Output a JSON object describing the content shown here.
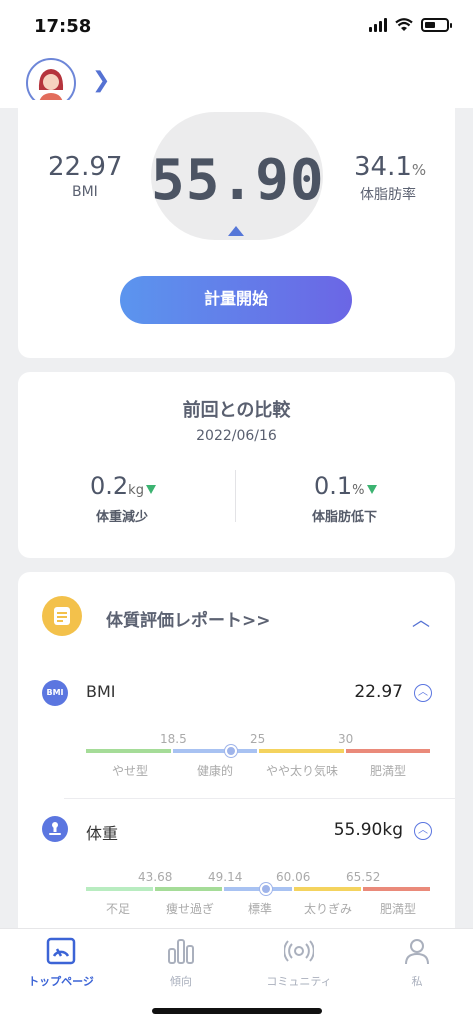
{
  "status_bar": {
    "time": "17:58"
  },
  "summary": {
    "bmi_value": "22.97",
    "bmi_label": "BMI",
    "weight_value": "55.90",
    "body_fat_value": "34.1",
    "body_fat_unit": "%",
    "body_fat_label": "体脂肪率",
    "start_button": "計量開始"
  },
  "comparison": {
    "title": "前回との比較",
    "date": "2022/06/16",
    "weight_change": "0.2",
    "weight_unit": "kg",
    "weight_label": "体重減少",
    "fat_change": "0.1",
    "fat_unit": "%",
    "fat_label": "体脂肪低下"
  },
  "report": {
    "title": "体質評価レポート>>",
    "bmi": {
      "icon_text": "BMI",
      "name": "BMI",
      "value": "22.97",
      "ticks": [
        "18.5",
        "25",
        "30"
      ],
      "categories": [
        "やせ型",
        "健康的",
        "やや太り気味",
        "肥満型"
      ],
      "marker_fraction": 0.42,
      "colors": [
        "#a5dc98",
        "#a8c2f2",
        "#f4d35e",
        "#ea8a7a"
      ]
    },
    "weight": {
      "name": "体重",
      "value": "55.90kg",
      "ticks": [
        "43.68",
        "49.14",
        "60.06",
        "65.52"
      ],
      "categories": [
        "不足",
        "痩せ過ぎ",
        "標準",
        "太りぎみ",
        "肥満型"
      ],
      "marker_fraction": 0.52,
      "colors": [
        "#b8ecc0",
        "#a5dc98",
        "#a8c2f2",
        "#f4d35e",
        "#ea8a7a"
      ]
    }
  },
  "tabs": [
    {
      "label": "トップページ",
      "icon": "home-gauge-icon",
      "active": true
    },
    {
      "label": "傾向",
      "icon": "bar-chart-icon",
      "active": false
    },
    {
      "label": "コミュニティ",
      "icon": "community-icon",
      "active": false
    },
    {
      "label": "私",
      "icon": "person-icon",
      "active": false
    }
  ]
}
